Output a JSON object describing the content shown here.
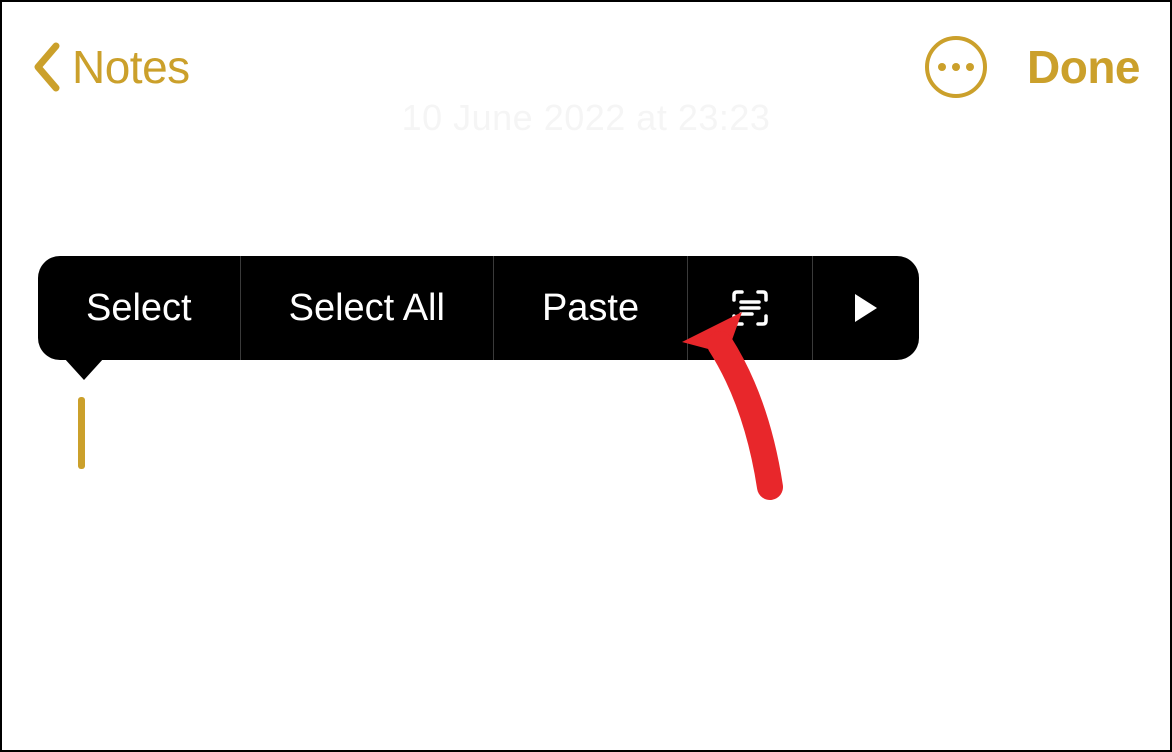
{
  "header": {
    "back_label": "Notes",
    "done_label": "Done"
  },
  "timestamp": "10 June 2022 at 23:23",
  "context_menu": {
    "select_label": "Select",
    "select_all_label": "Select All",
    "paste_label": "Paste"
  },
  "colors": {
    "accent": "#CBA02B",
    "menu_bg": "#000000",
    "annotation": "#E8272B"
  }
}
